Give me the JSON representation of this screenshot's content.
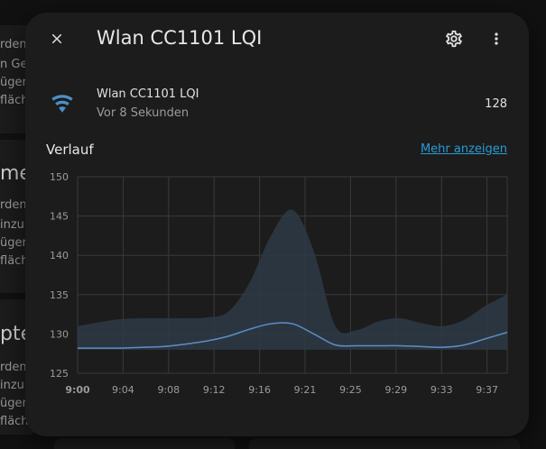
{
  "background": {
    "fragments": [
      "rden",
      "n Ge",
      "ügen",
      "fläch",
      "men",
      "rden",
      "inzu",
      "ügen",
      "fläch",
      "pte",
      "rden",
      "inzu",
      "ügen",
      "fläch"
    ]
  },
  "dialog": {
    "title": "Wlan CC1101 LQI",
    "close_icon": "close-icon",
    "settings_icon": "gear-icon",
    "more_icon": "dots-vertical-icon"
  },
  "entity": {
    "icon": "wifi-icon",
    "name": "Wlan CC1101 LQI",
    "last_changed": "Vor 8 Sekunden",
    "value": "128"
  },
  "history": {
    "title": "Verlauf",
    "more_link": "Mehr anzeigen"
  },
  "colors": {
    "accent": "#2a9bd6",
    "line": "#5b8fc4",
    "band": "#2e3a47",
    "icon": "#4a90c9"
  },
  "chart_data": {
    "type": "area",
    "x": [
      "9:00",
      "9:02",
      "9:04",
      "9:06",
      "9:08",
      "9:10",
      "9:12",
      "9:14",
      "9:16",
      "9:18",
      "9:20",
      "9:22",
      "9:24",
      "9:26",
      "9:28",
      "9:30",
      "9:32",
      "9:34",
      "9:36",
      "9:38",
      "9:40"
    ],
    "x_tick_labels": [
      "9:00",
      "9:04",
      "9:08",
      "9:12",
      "9:16",
      "9:21",
      "9:25",
      "9:29",
      "9:33",
      "9:37"
    ],
    "series": [
      {
        "values": [
          128.2,
          128.2,
          128.2,
          128.3,
          128.4,
          128.7,
          129.1,
          129.7,
          130.6,
          131.3,
          131.3,
          130.0,
          128.6,
          128.5,
          128.5,
          128.5,
          128.4,
          128.3,
          128.6,
          129.4,
          130.2
        ]
      }
    ],
    "band_max": [
      131.0,
      131.5,
      131.9,
      132.0,
      132.0,
      132.0,
      132.1,
      132.8,
      136.5,
      142.5,
      145.8,
      140.5,
      131.0,
      130.5,
      131.6,
      132.0,
      131.4,
      131.0,
      131.8,
      133.6,
      135.0
    ],
    "band_min": [
      128.0,
      128.0,
      128.0,
      128.0,
      128.0,
      128.0,
      128.0,
      128.0,
      128.0,
      128.0,
      128.0,
      128.0,
      128.0,
      128.0,
      128.0,
      128.0,
      128.0,
      128.0,
      128.0,
      128.0,
      128.0
    ],
    "y_ticks": [
      125,
      130,
      135,
      140,
      145,
      150
    ],
    "ylim": [
      125,
      150
    ],
    "grid": true
  }
}
